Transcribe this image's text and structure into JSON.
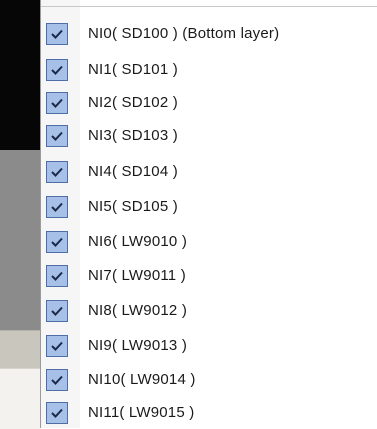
{
  "menu": {
    "items": [
      {
        "label": "NI0( SD100 ) (Bottom layer)",
        "checked": true
      },
      {
        "label": "NI1( SD101 )",
        "checked": true
      },
      {
        "label": "NI2( SD102 )",
        "checked": true
      },
      {
        "label": "NI3( SD103 )",
        "checked": true
      },
      {
        "label": "NI4( SD104 )",
        "checked": true
      },
      {
        "label": "NI5( SD105 )",
        "checked": true
      },
      {
        "label": "NI6( LW9010 )",
        "checked": true
      },
      {
        "label": "NI7( LW9011 )",
        "checked": true
      },
      {
        "label": "NI8( LW9012 )",
        "checked": true
      },
      {
        "label": "NI9( LW9013 )",
        "checked": true
      },
      {
        "label": "NI10( LW9014 )",
        "checked": true
      },
      {
        "label": "NI11( LW9015 )",
        "checked": true
      }
    ]
  },
  "colors": {
    "checkbox_fill": "#a6c0e8",
    "checkbox_border": "#4f6ea6",
    "checkmark": "#1b2a4a"
  }
}
